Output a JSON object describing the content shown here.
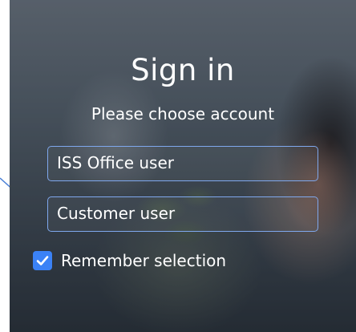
{
  "signin": {
    "title": "Sign in",
    "subtitle": "Please choose account",
    "accounts": [
      {
        "label": "ISS Office user"
      },
      {
        "label": "Customer user"
      }
    ],
    "remember": {
      "label": "Remember selection",
      "checked": true
    }
  },
  "colors": {
    "button_border": "#7fa8ee",
    "checkbox": "#3b82f6",
    "text": "#ffffff",
    "annotation_arrow": "#4a7fd6"
  },
  "icons": {
    "checkbox": "checkmark-icon",
    "annotation": "arrow-icon"
  }
}
